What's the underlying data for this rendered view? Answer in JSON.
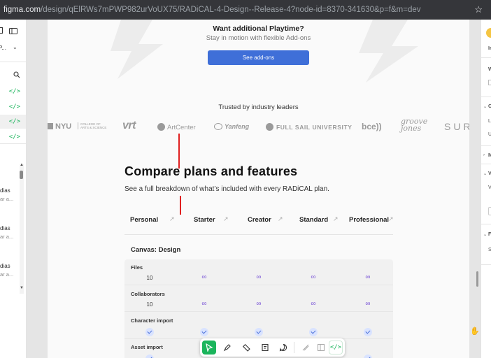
{
  "browser": {
    "url_host": "figma.com",
    "url_path": "/design/qElRWs7mPWP982urVoUX75/RADiCAL-4-Design--Release-4?node-id=8370-341630&p=f&m=dev",
    "star_icon": "star-icon"
  },
  "left_panel": {
    "code_tag": "</>",
    "rows": [
      {
        "text": "dias",
        "sub": "ar a..."
      },
      {
        "text": "dias",
        "sub": "ar a..."
      },
      {
        "text": "dias",
        "sub": "ar a..."
      }
    ],
    "collapse_glyph": "⌄"
  },
  "addons": {
    "title": "Want additional Playtime?",
    "subtitle": "Stay in motion with flexible Add-ons",
    "button": "See add-ons"
  },
  "trusted": {
    "heading": "Trusted by industry leaders",
    "logos": [
      "NYU",
      "COLLEGE OF ARTS & SCIENCE",
      "vrt",
      "ArtCenter",
      "Yanfeng",
      "FULL SAIL UNIVERSITY",
      "bce))",
      "groove jones",
      "SUR"
    ]
  },
  "compare": {
    "title": "Compare plans and features",
    "subtitle": "See a full breakdown of what’s included with every RADiCAL plan.",
    "arrow": "↗",
    "plans": [
      "Personal",
      "Starter",
      "Creator",
      "Standard",
      "Professional"
    ],
    "section": "Canvas: Design",
    "features": [
      {
        "name": "Files",
        "values": [
          "10",
          "∞",
          "∞",
          "∞",
          "∞"
        ]
      },
      {
        "name": "Collaborators",
        "values": [
          "10",
          "∞",
          "∞",
          "∞",
          "∞"
        ]
      },
      {
        "name": "Character import",
        "values": [
          "check",
          "check",
          "check",
          "check",
          "check"
        ]
      },
      {
        "name": "Asset import",
        "values": [
          "check",
          "check",
          "check",
          "check",
          "check"
        ]
      }
    ]
  },
  "toolbar": {
    "tools": [
      "move-tool",
      "pen-tool",
      "ruler-tool",
      "annotation-tool",
      "comment-tool",
      "ready-for-dev-tool",
      "inspect-tool",
      "dev-mode-toggle"
    ],
    "code_label": "</>"
  },
  "right_panel": {
    "items": [
      "In",
      "W",
      "C",
      "L",
      "U",
      "M",
      "V",
      "V",
      "F",
      "S"
    ]
  },
  "colors": {
    "accent_button": "#3f6fd8",
    "dev_green": "#1bb55c",
    "infinity_purple": "#7a55d6",
    "annotation_red": "#e02020"
  }
}
